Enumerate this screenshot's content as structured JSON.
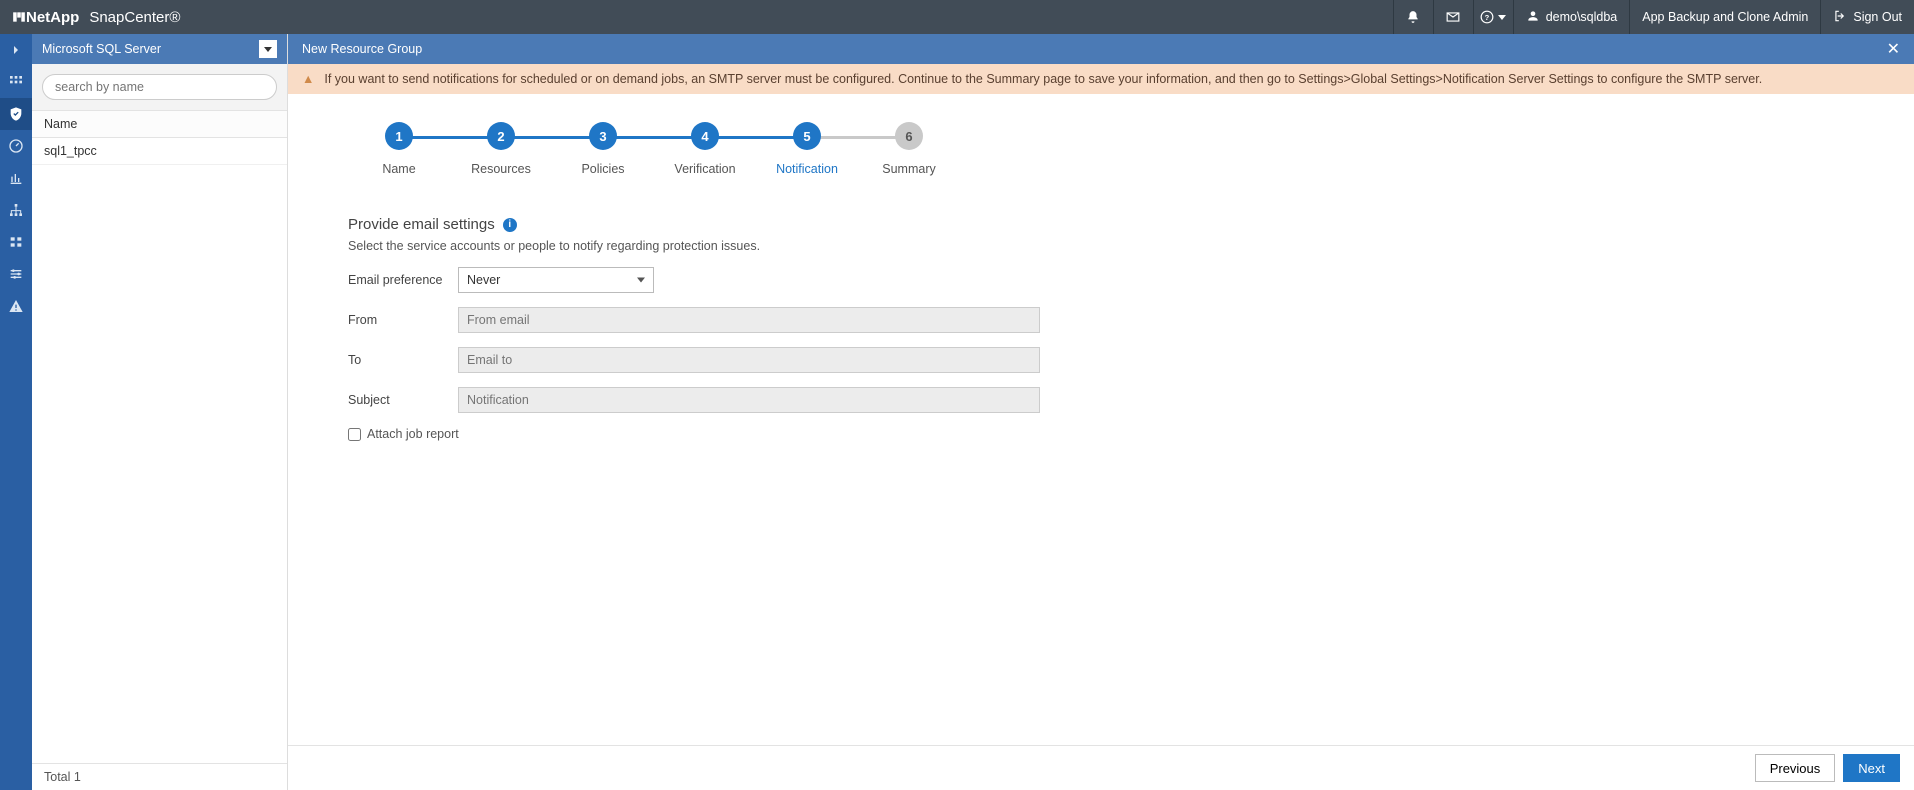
{
  "brand": {
    "company": "NetApp",
    "product": "SnapCenter®"
  },
  "topbar": {
    "user": "demo\\sqldba",
    "role": "App Backup and Clone Admin",
    "signout": "Sign Out"
  },
  "sidepanel": {
    "plugin": "Microsoft SQL Server",
    "search_placeholder": "search by name",
    "column": "Name",
    "rows": [
      "sql1_tpcc"
    ],
    "total_label": "Total 1"
  },
  "content": {
    "title": "New Resource Group",
    "alert": "If you want to send notifications for scheduled or on demand jobs, an SMTP server must be configured. Continue to the Summary page to save your information, and then go to Settings>Global Settings>Notification Server Settings to configure the SMTP server."
  },
  "steps": [
    {
      "num": "1",
      "label": "Name"
    },
    {
      "num": "2",
      "label": "Resources"
    },
    {
      "num": "3",
      "label": "Policies"
    },
    {
      "num": "4",
      "label": "Verification"
    },
    {
      "num": "5",
      "label": "Notification"
    },
    {
      "num": "6",
      "label": "Summary"
    }
  ],
  "form": {
    "title": "Provide email settings",
    "subtitle": "Select the service accounts or people to notify regarding protection issues.",
    "pref_label": "Email preference",
    "pref_value": "Never",
    "from_label": "From",
    "from_placeholder": "From email",
    "to_label": "To",
    "to_placeholder": "Email to",
    "subject_label": "Subject",
    "subject_placeholder": "Notification",
    "attach_label": "Attach job report"
  },
  "footer": {
    "prev": "Previous",
    "next": "Next"
  }
}
